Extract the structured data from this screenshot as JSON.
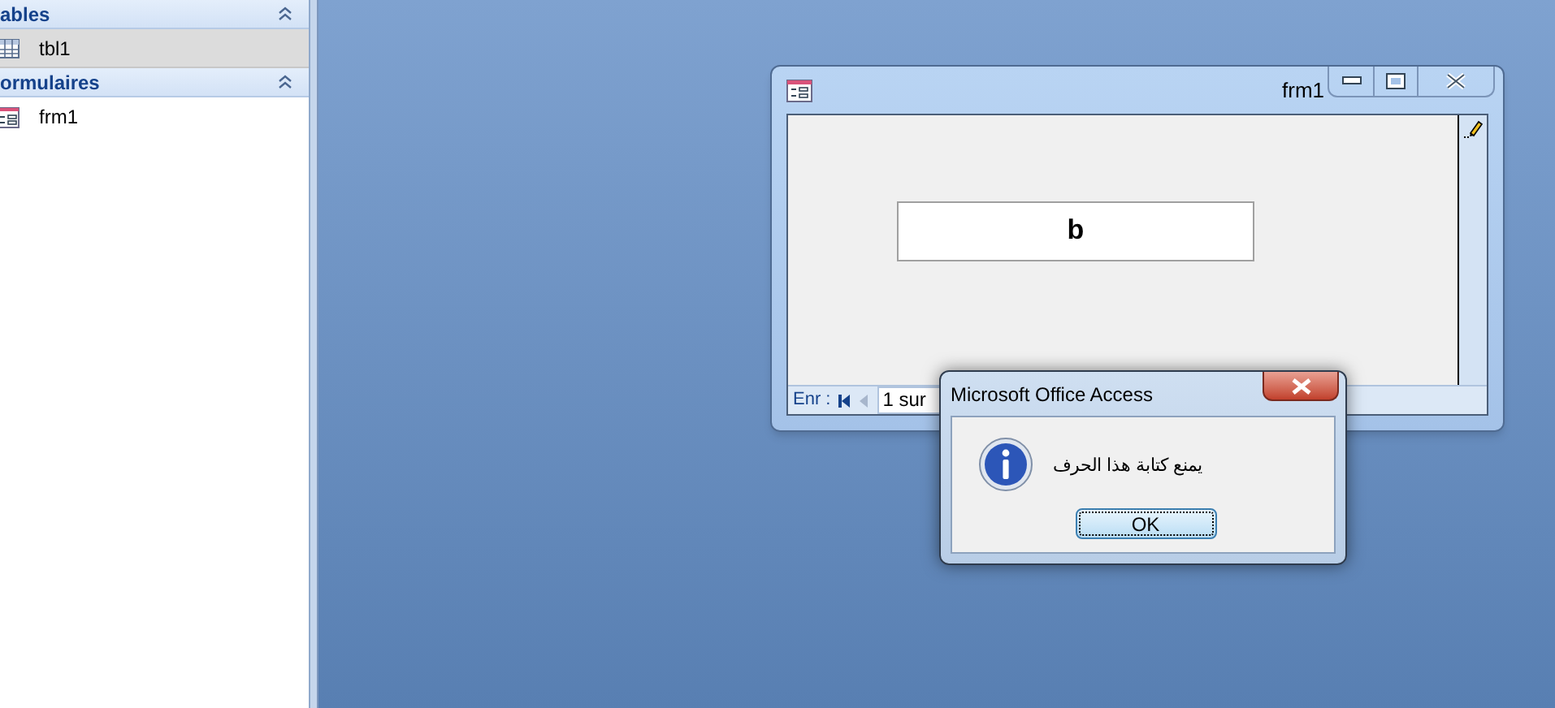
{
  "nav_pane": {
    "groups": [
      {
        "title": "ables",
        "items": [
          {
            "label": "tbl1",
            "kind": "table",
            "selected": true
          }
        ]
      },
      {
        "title": "ormulaires",
        "items": [
          {
            "label": "frm1",
            "kind": "form",
            "selected": false
          }
        ]
      }
    ]
  },
  "form_window": {
    "title": "frm1",
    "text_box": {
      "value": "b"
    },
    "navigation": {
      "label": "Enr :",
      "record": "1 sur"
    }
  },
  "dialog": {
    "title": "Microsoft Office Access",
    "message": "يمنع كتابة هذا الحرف",
    "button": "OK"
  }
}
